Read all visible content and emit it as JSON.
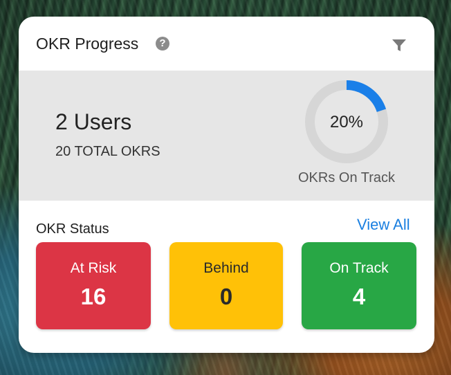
{
  "card": {
    "title": "OKR Progress",
    "help_icon": "question-circle-icon",
    "filter_icon": "filter-icon"
  },
  "summary": {
    "users": "2 Users",
    "total_okrs": "20 TOTAL OKRS",
    "percent_label": "20%",
    "percent_value": 20,
    "donut_caption": "OKRs On Track",
    "track_color": "#d6d6d6",
    "progress_color": "#1a7fe8"
  },
  "status": {
    "title": "OKR Status",
    "view_all": "View All",
    "tiles": [
      {
        "label": "At Risk",
        "value": "16",
        "color": "#dc3545",
        "text_color": "#ffffff"
      },
      {
        "label": "Behind",
        "value": "0",
        "color": "#ffc107",
        "text_color": "#2a2a2a"
      },
      {
        "label": "On Track",
        "value": "4",
        "color": "#28a745",
        "text_color": "#ffffff"
      }
    ]
  }
}
